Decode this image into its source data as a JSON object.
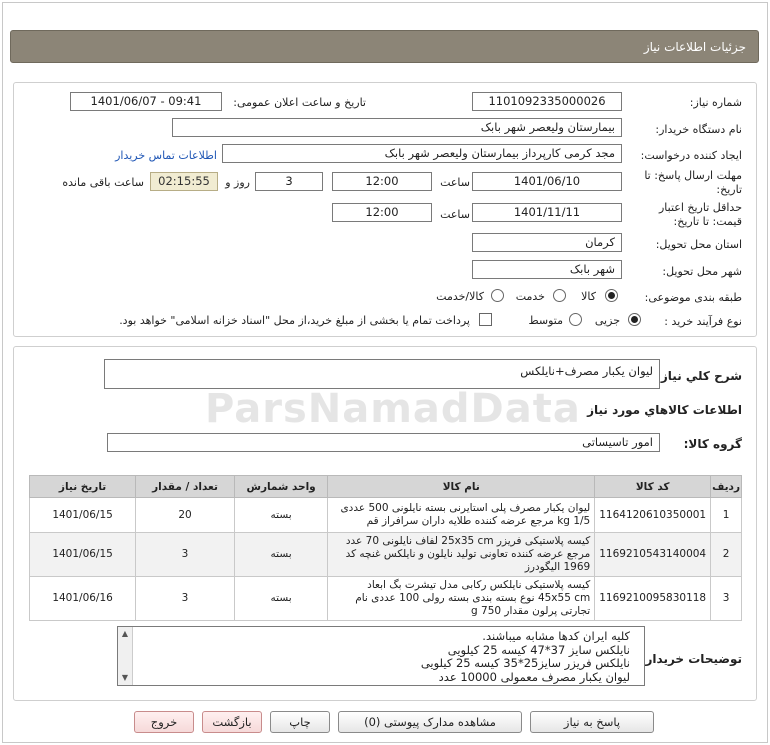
{
  "header": {
    "title": "جزئیات اطلاعات نیاز"
  },
  "fields": {
    "need_number_label": "شماره نیاز:",
    "need_number": "1101092335000026",
    "announce_label": "تاریخ و ساعت اعلان عمومی:",
    "announce_value": "1401/06/07 - 09:41",
    "buyer_org_label": "نام دستگاه خریدار:",
    "buyer_org": "بیمارستان ولیعصر شهر بابک",
    "creator_label": "ایجاد کننده درخواست:",
    "creator": "مجد  کرمی  کارپرداز  بیمارستان ولیعصر شهر بابک",
    "contact_link": "اطلاعات تماس خریدار",
    "deadline_label": "مهلت ارسال پاسخ: تا",
    "deadline_label2": "تاریخ:",
    "deadline_date": "1401/06/10",
    "time_label": "ساعت",
    "deadline_time": "12:00",
    "days_value": "3",
    "days_label": "روز و",
    "remaining_time": "02:15:55",
    "remaining_label": "ساعت باقی مانده",
    "validity_label": "حداقل تاریخ اعتبار",
    "validity_label2": "قیمت: تا تاریخ:",
    "validity_date": "1401/11/11",
    "validity_time": "12:00",
    "province_label": "استان محل تحویل:",
    "province": "کرمان",
    "city_label": "شهر محل تحویل:",
    "city": "شهر بابک",
    "category_label": "طبقه بندی موضوعی:",
    "category_options": [
      "کالا",
      "خدمت",
      "کالا/خدمت"
    ],
    "process_label": "نوع فرآیند خرید :",
    "process_options": [
      "جزیی",
      "متوسط"
    ],
    "payment_note": "پرداخت تمام یا بخشی از مبلغ خرید،از محل \"اسناد خزانه اسلامی\" خواهد بود."
  },
  "summary": {
    "label": "شرح کلي نياز:",
    "value": "لیوان یکبار مصرف+نایلکس"
  },
  "goods_section": {
    "title": "اطلاعات کالاهاي مورد نياز",
    "group_label": "گروه کالا:",
    "group_value": "امور تاسیساتی"
  },
  "table": {
    "headers": [
      "ردیف",
      "کد کالا",
      "نام کالا",
      "واحد شمارش",
      "تعداد / مقدار",
      "تاریخ نیاز"
    ],
    "rows": [
      {
        "idx": "1",
        "code": "1164120610350001",
        "name": "لیوان یکبار مصرف پلی استایرنی بسته نایلونی 500 عددی 1/5 kg مرجع عرضه کننده طلایه داران سرافراز قم",
        "unit": "بسته",
        "qty": "20",
        "date": "1401/06/15"
      },
      {
        "idx": "2",
        "code": "1169210543140004",
        "name": "کیسه پلاستیکی فریزر 25x35 cm لفاف نایلونی 70 عدد مرجع عرضه کننده تعاونی تولید نایلون و نایلکس غنچه کد 1969 الیگودرز",
        "unit": "بسته",
        "qty": "3",
        "date": "1401/06/15"
      },
      {
        "idx": "3",
        "code": "1169210095830118",
        "name": "کیسه پلاستیکی نایلکس رکابی مدل تیشرت بگ ابعاد 45x55 cm نوع بسته بندی بسته رولی 100 عددی نام تجارتی پرلون مقدار 750 g",
        "unit": "بسته",
        "qty": "3",
        "date": "1401/06/16"
      }
    ]
  },
  "buyer_notes": {
    "label": "توضیحات خریدار:",
    "lines": [
      "کلیه ایران کدها مشابه میباشند.",
      "نایلکس سایز 37*47 کیسه 25 کیلویی",
      "نایلکس فریزر سایز25*35 کیسه 25 کیلویی",
      "لیوان یکبار مصرف معمولی 10000 عدد"
    ]
  },
  "buttons": {
    "reply": "پاسخ به نیاز",
    "attachments": "مشاهده مدارک پیوستی (0)",
    "print": "چاپ",
    "back": "بازگشت",
    "exit": "خروج"
  },
  "watermark": "ParsNamadData"
}
